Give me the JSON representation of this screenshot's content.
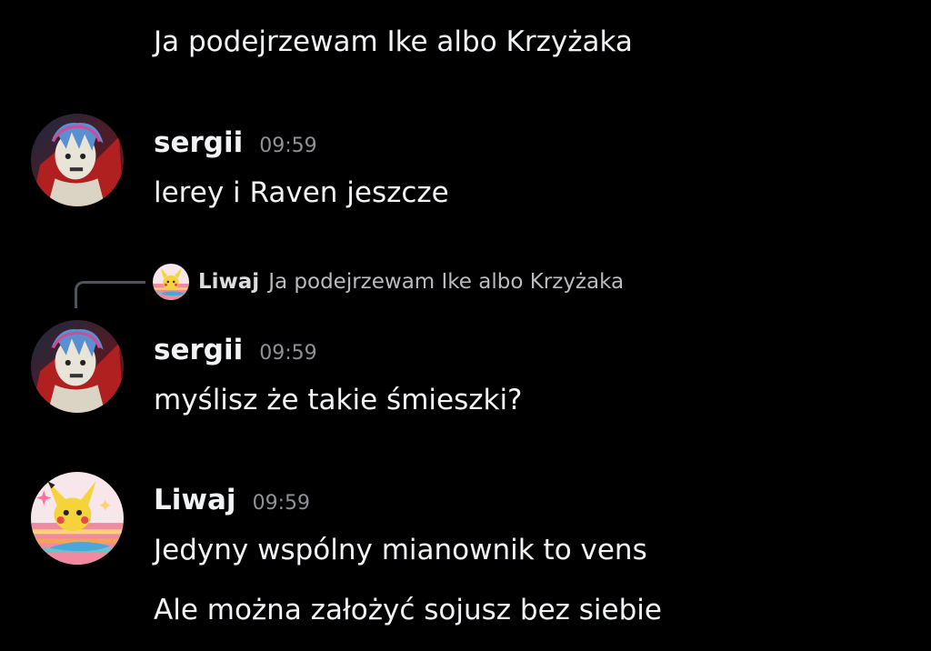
{
  "messages": [
    {
      "type": "continuation",
      "text": "Ja podejrzewam Ike albo Krzyżaka"
    },
    {
      "type": "message",
      "username": "sergii",
      "avatar": "sergii-avatar",
      "timestamp": "09:59",
      "lines": [
        "lerey i Raven jeszcze"
      ]
    },
    {
      "type": "message",
      "username": "sergii",
      "avatar": "sergii-avatar",
      "timestamp": "09:59",
      "reply": {
        "username": "Liwaj",
        "avatar": "liwaj-avatar",
        "text": "Ja podejrzewam Ike albo Krzyżaka"
      },
      "lines": [
        "myślisz że takie śmieszki?"
      ]
    },
    {
      "type": "message",
      "username": "Liwaj",
      "avatar": "liwaj-avatar",
      "timestamp": "09:59",
      "lines": [
        "Jedyny wspólny mianownik to vens",
        "Ale można założyć sojusz bez siebie"
      ]
    }
  ],
  "colors": {
    "background": "#000000",
    "text": "#f2f3f5",
    "timestamp": "#8e9297",
    "reply_text": "#b9bbbe",
    "reply_spine": "#4f545c"
  }
}
